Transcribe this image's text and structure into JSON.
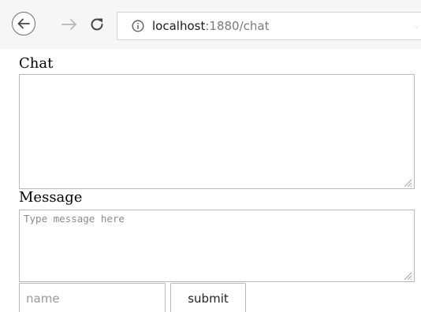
{
  "browser": {
    "url_host": "localhost",
    "url_path": ":1880/chat",
    "icons": {
      "back": "arrow-left-circle",
      "forward": "arrow-right",
      "reload": "reload",
      "info": "info-circle",
      "dropdown": "chevron-down"
    }
  },
  "chat": {
    "label": "Chat",
    "value": ""
  },
  "message": {
    "label": "Message",
    "placeholder": "Type message here",
    "value": ""
  },
  "form": {
    "name_placeholder": "name",
    "name_value": "",
    "submit_label": "submit"
  },
  "colors": {
    "toolbar_bg": "#f6f6f6",
    "field_border": "#b9b9b9",
    "url_path": "#7a7a7a"
  }
}
